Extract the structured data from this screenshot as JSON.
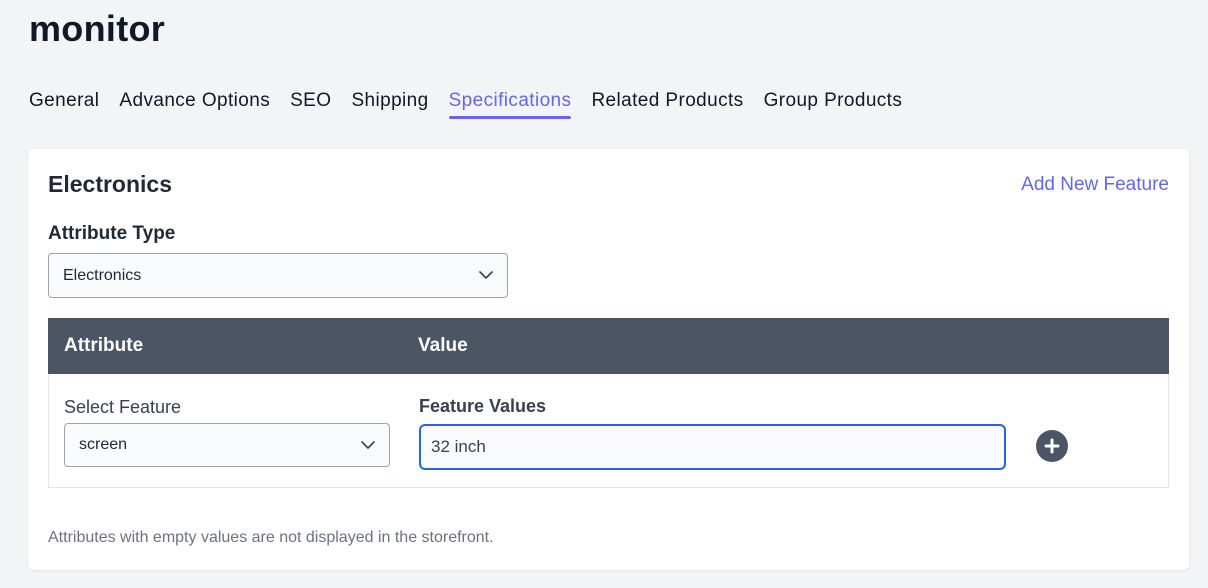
{
  "page": {
    "title": "monitor"
  },
  "tabs": [
    {
      "label": "General"
    },
    {
      "label": "Advance Options"
    },
    {
      "label": "SEO"
    },
    {
      "label": "Shipping"
    },
    {
      "label": "Specifications",
      "active": true
    },
    {
      "label": "Related Products"
    },
    {
      "label": "Group Products"
    }
  ],
  "card": {
    "title": "Electronics",
    "add_feature_label": "Add New Feature",
    "attribute_type": {
      "label": "Attribute Type",
      "selected": "Electronics"
    },
    "table": {
      "headers": {
        "attribute": "Attribute",
        "value": "Value"
      },
      "row": {
        "select_label": "Select Feature",
        "feature_selected": "screen",
        "values_label": "Feature Values",
        "values_value": "32 inch"
      }
    },
    "note": "Attributes with empty values are not displayed in the storefront."
  },
  "icons": {
    "dropdown": "chevron-down-icon",
    "add": "plus-circle-icon"
  },
  "colors": {
    "accent": "#6366f1",
    "table_header": "#4b5563",
    "focus_border": "#2563eb"
  }
}
